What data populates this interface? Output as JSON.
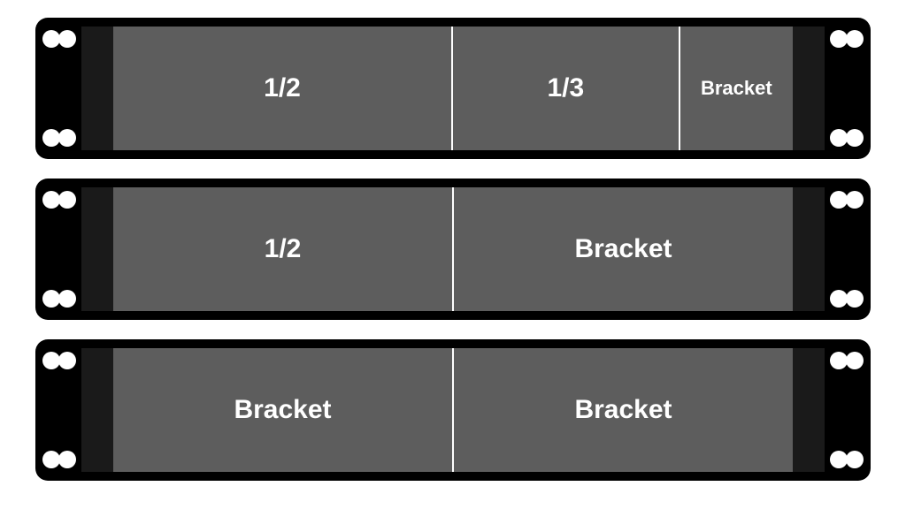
{
  "racks": [
    {
      "slots": [
        {
          "size": "half",
          "label": "1/2"
        },
        {
          "size": "third",
          "label": "1/3"
        },
        {
          "size": "remainder-small",
          "label": "Bracket"
        }
      ]
    },
    {
      "slots": [
        {
          "size": "half-eq",
          "label": "1/2"
        },
        {
          "size": "half-eq",
          "label": "Bracket"
        }
      ]
    },
    {
      "slots": [
        {
          "size": "half-eq",
          "label": "Bracket"
        },
        {
          "size": "half-eq",
          "label": "Bracket"
        }
      ]
    }
  ]
}
